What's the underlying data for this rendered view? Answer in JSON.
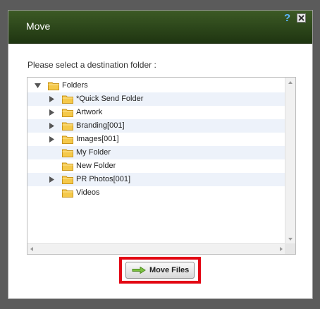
{
  "dialog": {
    "title": "Move",
    "help_icon": "?",
    "prompt": "Please select a destination folder :"
  },
  "tree": {
    "items": [
      {
        "label": "Folders",
        "expanded": true,
        "has_children": true,
        "level": 0,
        "icon": "folder-icon"
      },
      {
        "label": "*Quick Send Folder",
        "expanded": false,
        "has_children": true,
        "level": 1,
        "icon": "folder-icon"
      },
      {
        "label": "Artwork",
        "expanded": false,
        "has_children": true,
        "level": 1,
        "icon": "folder-icon"
      },
      {
        "label": "Branding[001]",
        "expanded": false,
        "has_children": true,
        "level": 1,
        "icon": "folder-icon"
      },
      {
        "label": "Images[001]",
        "expanded": false,
        "has_children": true,
        "level": 1,
        "icon": "folder-icon"
      },
      {
        "label": "My Folder",
        "expanded": false,
        "has_children": false,
        "level": 1,
        "icon": "folder-icon"
      },
      {
        "label": "New Folder",
        "expanded": false,
        "has_children": false,
        "level": 1,
        "icon": "folder-icon"
      },
      {
        "label": "PR Photos[001]",
        "expanded": false,
        "has_children": true,
        "level": 1,
        "icon": "folder-icon"
      },
      {
        "label": "Videos",
        "expanded": false,
        "has_children": false,
        "level": 1,
        "icon": "folder-icon"
      }
    ]
  },
  "actions": {
    "move_label": "Move Files",
    "move_icon": "green-arrow-icon"
  },
  "colors": {
    "titlebar": "#2b4419",
    "highlight": "#e30613",
    "folder": "#f5c94a",
    "row_alt": "#edf2fa"
  }
}
